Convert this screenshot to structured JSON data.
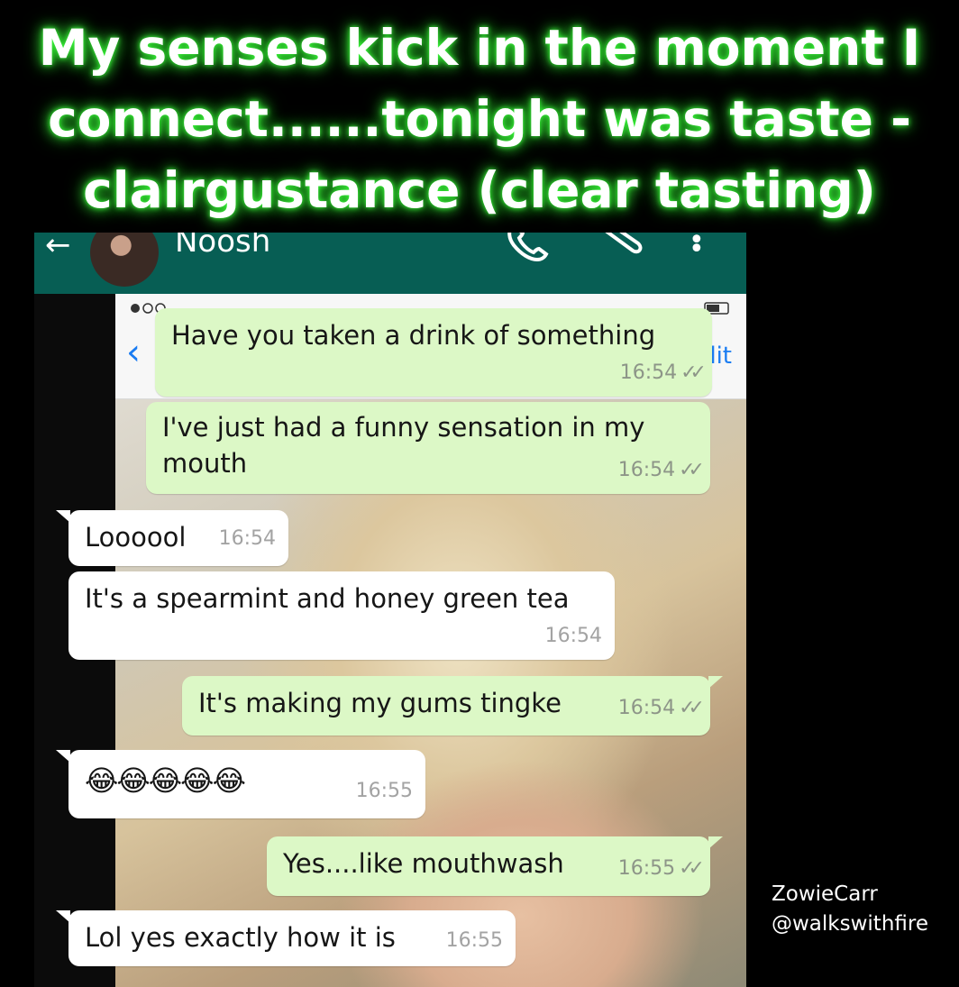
{
  "caption": {
    "line1": "My senses kick in the moment I",
    "line2": "connect......tonight was taste -",
    "line3": "clairgustance (clear tasting)"
  },
  "chat_header": {
    "contact_name": "Noosh"
  },
  "ios_bar": {
    "edit_label": "dit"
  },
  "messages": [
    {
      "text": "Have you taken a drink of something",
      "time": "16:54",
      "ticks": "✓✓"
    },
    {
      "text1": "I've just had a funny sensation in my",
      "text2": "mouth",
      "time": "16:54",
      "ticks": "✓✓"
    },
    {
      "text": "Loooool",
      "time": "16:54"
    },
    {
      "text": "It's a spearmint and honey green tea",
      "time": "16:54"
    },
    {
      "text": "It's making my gums tingke",
      "time": "16:54",
      "ticks": "✓✓"
    },
    {
      "text": "😂😂😂😂😂",
      "time": "16:55"
    },
    {
      "text": "Yes....like mouthwash",
      "time": "16:55",
      "ticks": "✓✓"
    },
    {
      "text": "Lol yes exactly how it is",
      "time": "16:55"
    }
  ],
  "credit": {
    "name": "ZowieCarr",
    "handle": "@walkswithfire"
  }
}
